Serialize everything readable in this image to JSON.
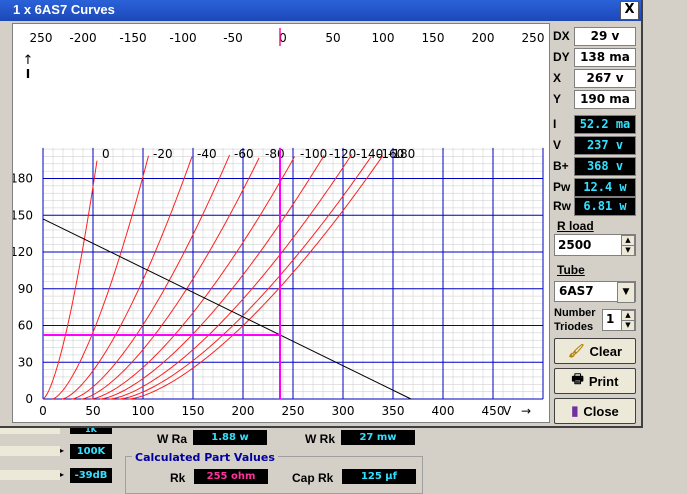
{
  "window": {
    "title": "1 x 6AS7 Curves",
    "close_label": "X"
  },
  "readouts": [
    {
      "key": "dx",
      "label": "DX",
      "value": "29 v"
    },
    {
      "key": "dy",
      "label": "DY",
      "value": "138 ma"
    },
    {
      "key": "x",
      "label": "X",
      "value": "267 v"
    },
    {
      "key": "y",
      "label": "Y",
      "value": "190 ma"
    }
  ],
  "calc": [
    {
      "key": "i",
      "label": "I",
      "value": "52.2 ma"
    },
    {
      "key": "v",
      "label": "V",
      "value": "237 v"
    },
    {
      "key": "bplus",
      "label": "B+",
      "value": "368 v"
    },
    {
      "key": "pw",
      "label": "Pw",
      "value": "12.4 w"
    },
    {
      "key": "rw",
      "label": "Rw",
      "value": "6.81 w"
    }
  ],
  "rload": {
    "label": "R load",
    "value": "2500"
  },
  "tube": {
    "label": "Tube",
    "selected": "6AS7"
  },
  "triodes": {
    "label_line1": "Number",
    "label_line2": "Triodes",
    "value": "1"
  },
  "buttons": {
    "clear": "Clear",
    "print": "Print",
    "close": "Close"
  },
  "bottom": {
    "wra_label": "W Ra",
    "wra_value": "1.88 w",
    "wrk_label": "W Rk",
    "wrk_value": "27 mw",
    "group_title": "Calculated Part Values",
    "rk_label": "Rk",
    "rk_value": "255 ohm",
    "caprk_label": "Cap Rk",
    "caprk_value": "125 µf"
  },
  "left_partial": {
    "val_100k": "100K",
    "val_db": "-39dB",
    "val_1k": "1K"
  },
  "colors": {
    "curve": "#ff2020",
    "grid": "#0000c0",
    "loadline": "#000000",
    "cursor": "#ff00ff",
    "marker": "#ff1493"
  },
  "chart_data": {
    "type": "line",
    "x_ticks": [
      "0",
      "50",
      "100",
      "150",
      "200",
      "250",
      "300",
      "350",
      "400",
      "450"
    ],
    "y_ticks": [
      "0",
      "30",
      "60",
      "90",
      "120",
      "150",
      "180"
    ],
    "top_ticks": [
      "250",
      "-200",
      "-150",
      "-100",
      "-50",
      "0",
      "50",
      "100",
      "150",
      "200",
      "250"
    ],
    "xlabel": "V",
    "ylabel": "I",
    "xlim": [
      0,
      490
    ],
    "ylim": [
      0,
      205
    ],
    "series": [
      {
        "name": "0",
        "x_end": 55
      },
      {
        "name": "-20",
        "x_end": 106
      },
      {
        "name": "-40",
        "x_end": 150
      },
      {
        "name": "-60",
        "x_end": 187
      },
      {
        "name": "-80",
        "x_end": 218
      },
      {
        "name": "-100",
        "x_end": 253
      },
      {
        "name": "-120",
        "x_end": 282
      },
      {
        "name": "-140",
        "x_end": 309
      },
      {
        "name": "-160",
        "x_end": 330
      },
      {
        "name": "-180",
        "x_end": 341
      }
    ],
    "loadline": {
      "x1": 0,
      "y1": 147,
      "x2": 368,
      "y2": 0
    },
    "cursor": {
      "v": 237,
      "i": 52.2
    }
  }
}
